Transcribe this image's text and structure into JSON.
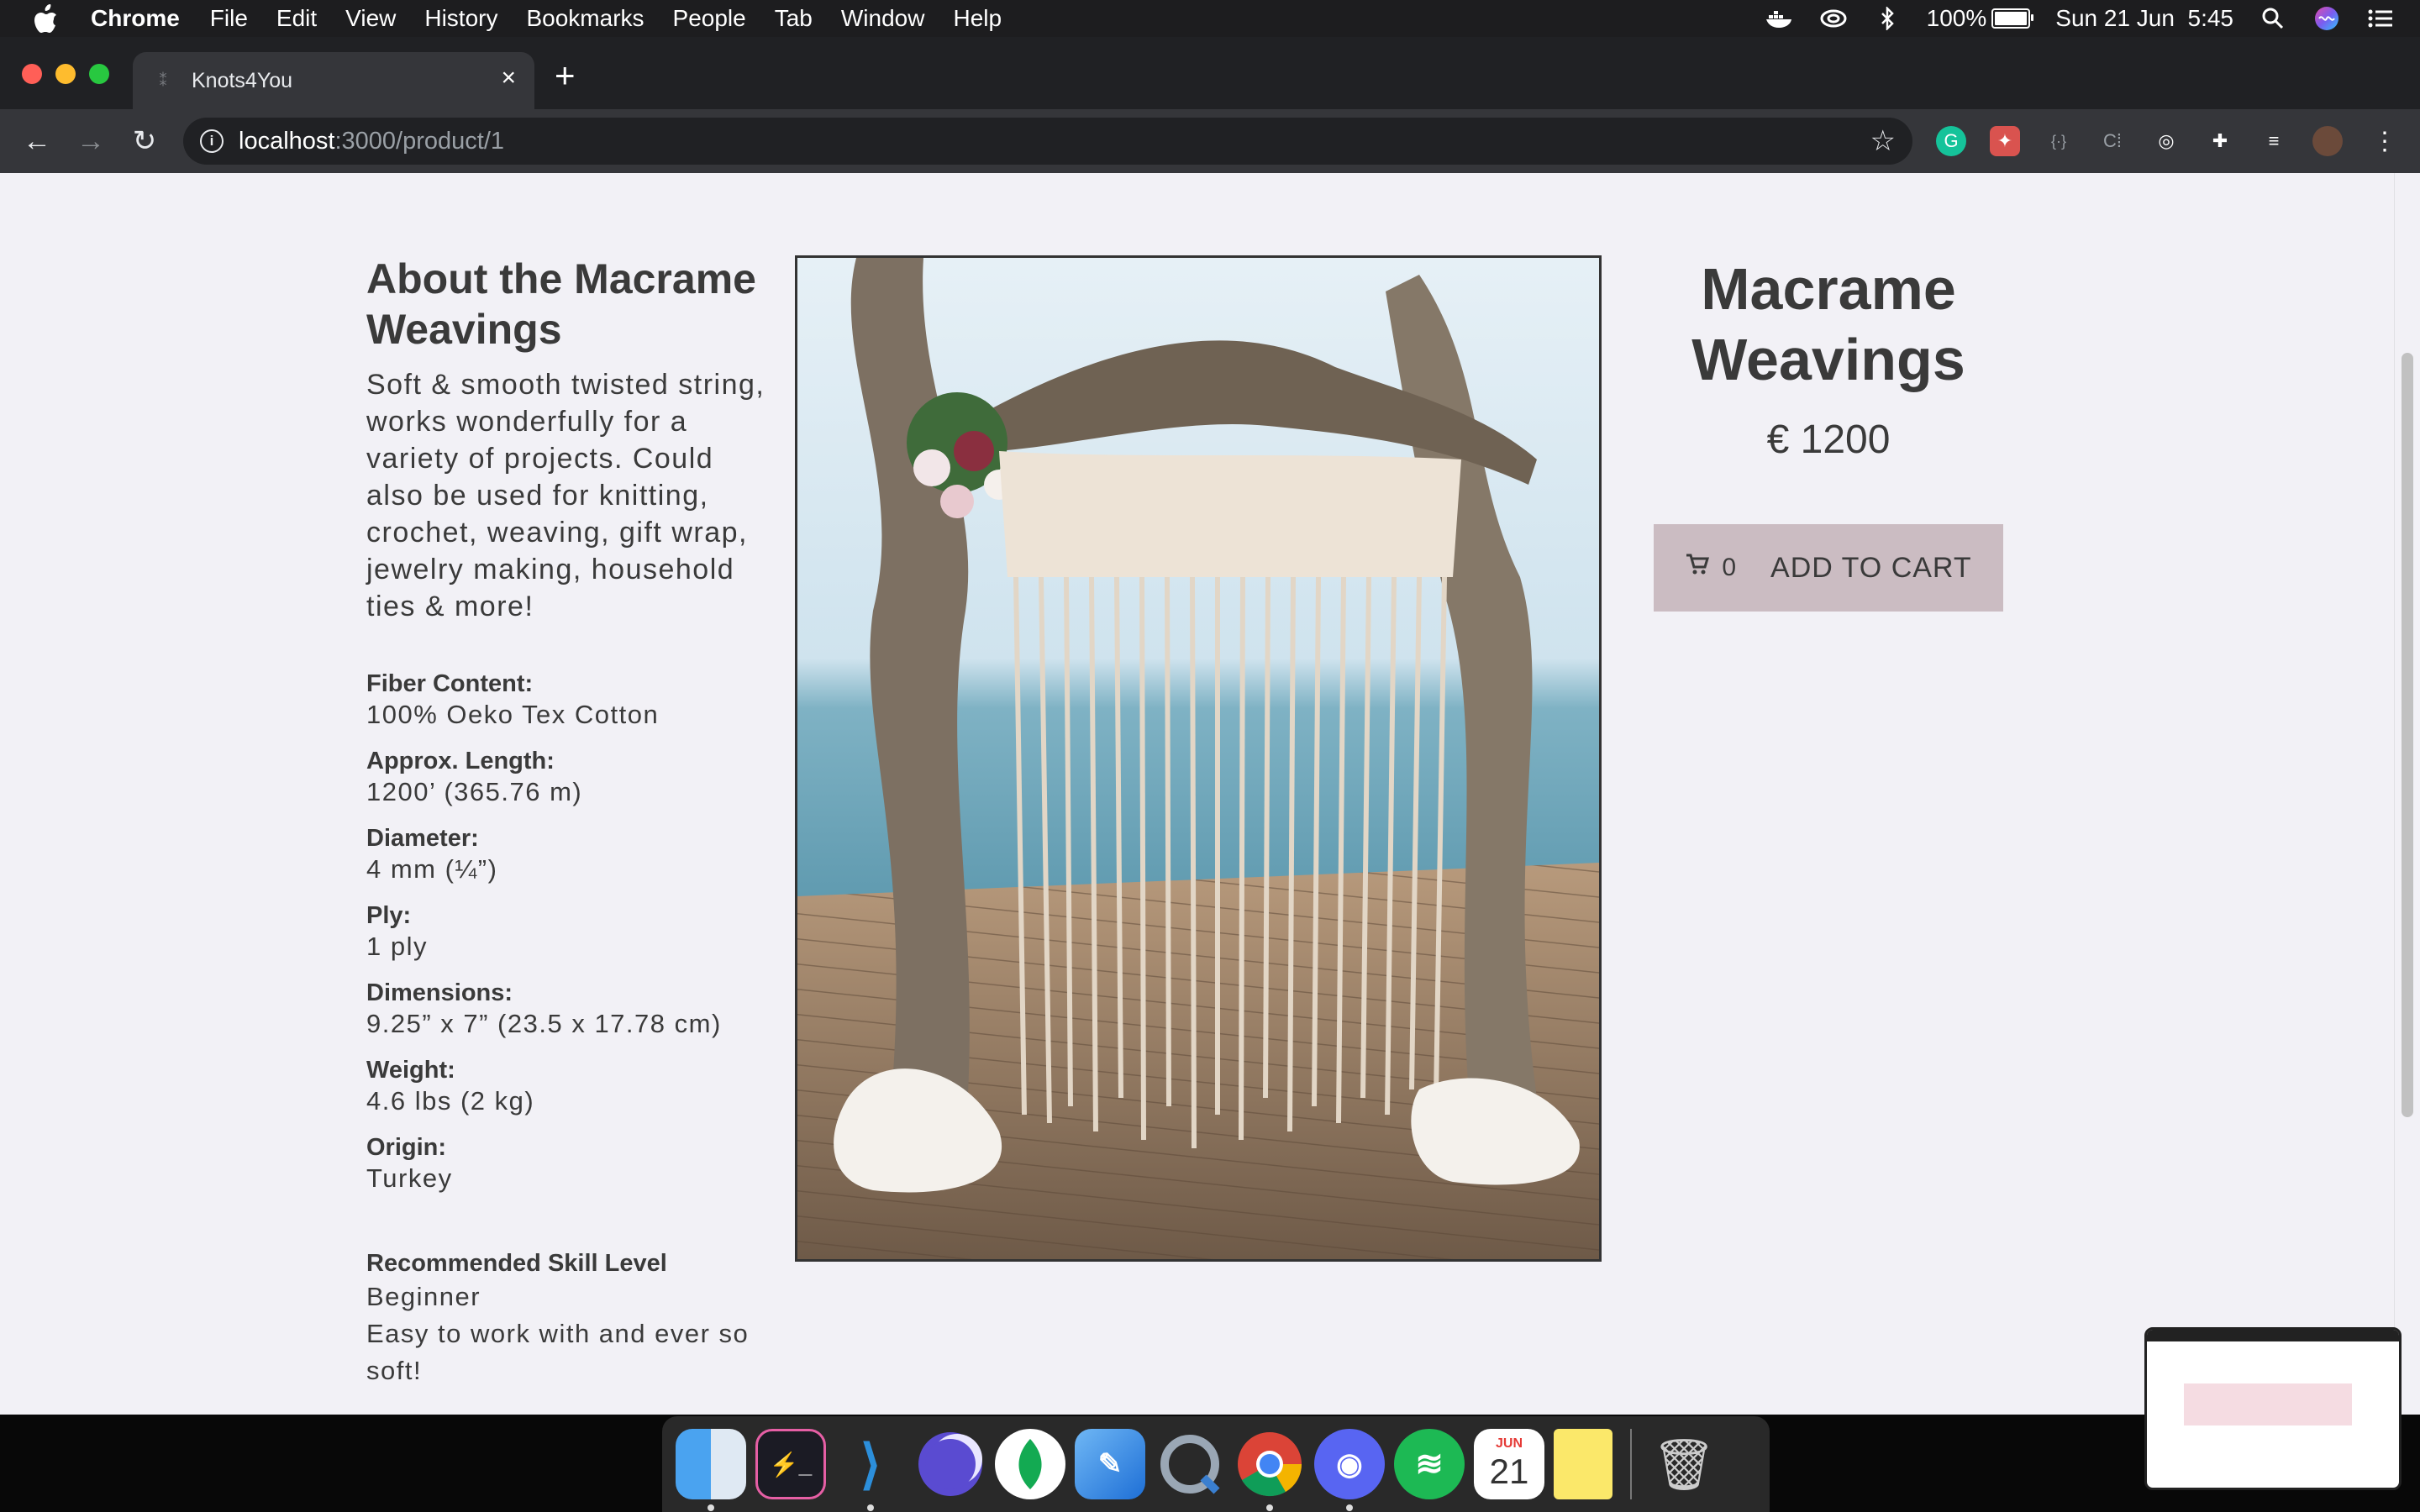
{
  "menubar": {
    "app_name": "Chrome",
    "items": [
      "File",
      "Edit",
      "View",
      "History",
      "Bookmarks",
      "People",
      "Tab",
      "Window",
      "Help"
    ],
    "battery": "100%",
    "battery_level": 1.0,
    "datetime": "Sun 21 Jun  5:45"
  },
  "browser": {
    "tab_title": "Knots4You",
    "url_host": "localhost",
    "url_path": ":3000/product/1"
  },
  "about": {
    "heading": "About the Macrame Weavings",
    "description": "Soft & smooth twisted string, works wonderfully for a variety of projects. Could also be used for knitting, crochet, weaving, gift wrap, jewelry making, household ties & more!",
    "specs": [
      {
        "label": "Fiber Content:",
        "value": "100% Oeko Tex Cotton"
      },
      {
        "label": "Approx. Length:",
        "value": "1200’ (365.76 m)"
      },
      {
        "label": "Diameter:",
        "value": "4 mm (¼”)"
      },
      {
        "label": "Ply:",
        "value": "1 ply"
      },
      {
        "label": "Dimensions:",
        "value": "9.25” x 7” (23.5 x 17.78 cm)"
      },
      {
        "label": "Weight:",
        "value": "4.6 lbs (2 kg)"
      },
      {
        "label": "Origin:",
        "value": "Turkey"
      }
    ],
    "skill_label": "Recommended Skill Level",
    "skill_value": "Beginner",
    "skill_note": "Easy to work with and ever so soft!"
  },
  "product": {
    "title": "Macrame Weavings",
    "price": "€ 1200",
    "cart_count": "0",
    "add_to_cart_label": "ADD TO CART"
  },
  "dock": {
    "calendar_month": "JUN",
    "calendar_day": "21"
  },
  "colors": {
    "page_background": "#f2f1f6",
    "button_background": "#cbbcc2",
    "text": "#3a3a3a"
  }
}
